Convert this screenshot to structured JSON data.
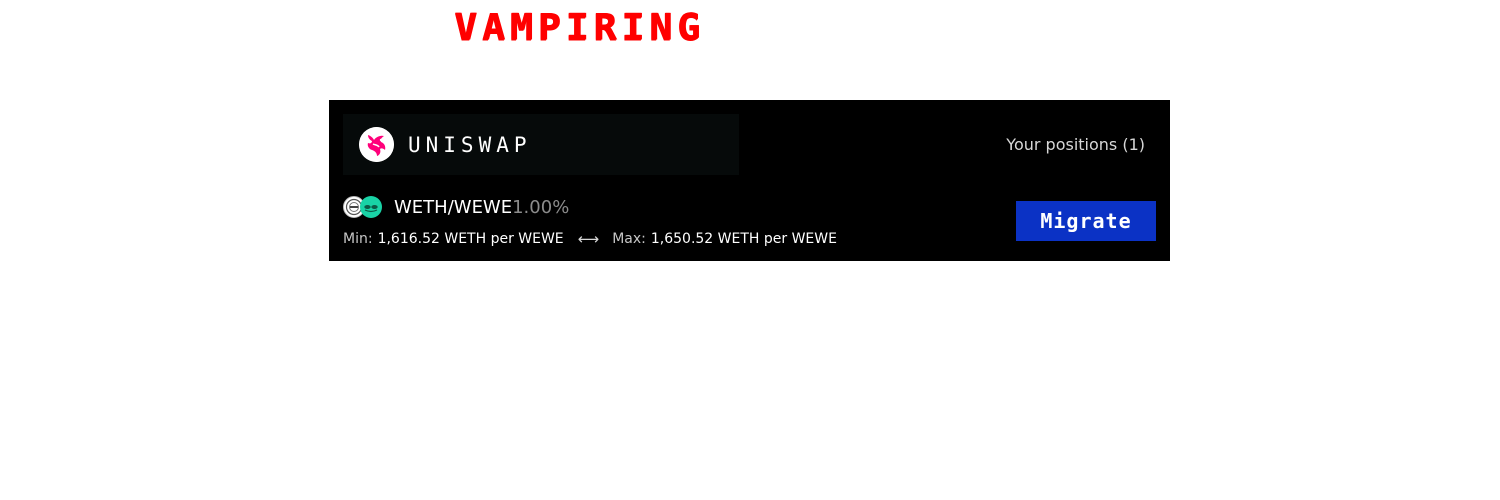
{
  "app": {
    "title": "VAMPIRING"
  },
  "protocol": {
    "name": "UNISWAP",
    "logo_icon": "uniswap-unicorn-icon",
    "positions_label": "Your positions (1)"
  },
  "position": {
    "pair": "WETH/WEWE",
    "fee": "1.00%",
    "token_icons": [
      "weth-icon",
      "wewe-icon"
    ],
    "min_label": "Min:",
    "min_value": "1,616.52 WETH per WEWE",
    "range_arrow": "⟷",
    "max_label": "Max:",
    "max_value": "1,650.52 WETH per WEWE",
    "action_label": "Migrate"
  },
  "colors": {
    "title": "#ff0000",
    "panel_background": "#000000",
    "button": "#0b32c5",
    "wewe_token": "#19d3a6",
    "uniswap_pink": "#ff007a"
  }
}
